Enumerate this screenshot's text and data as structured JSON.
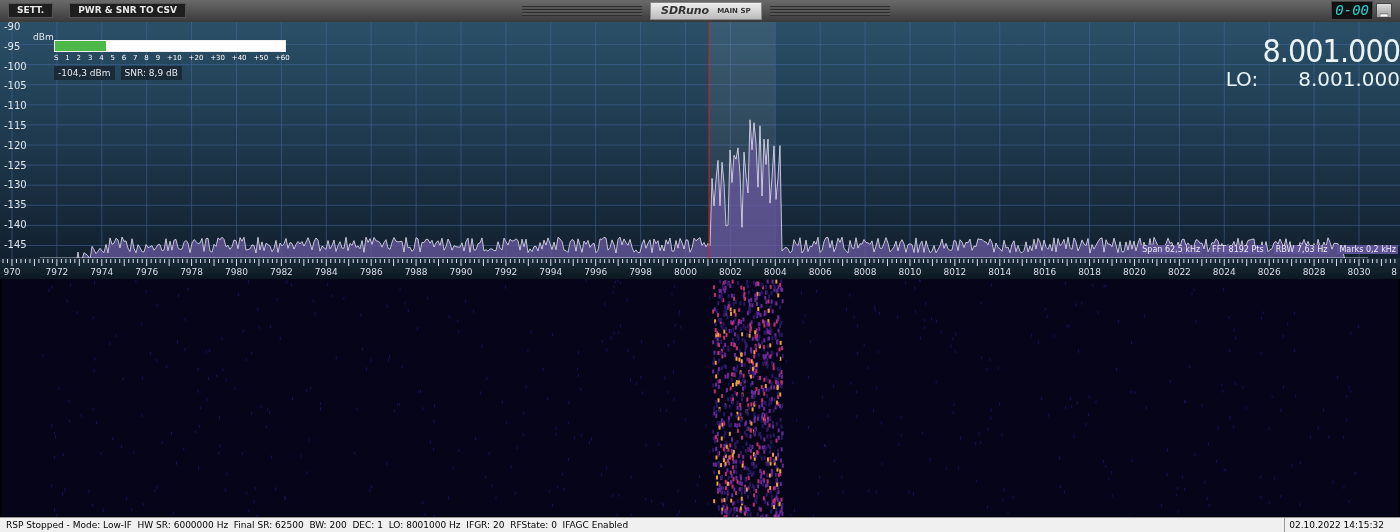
{
  "toolbar": {
    "buttons": [
      {
        "label": "SETT."
      },
      {
        "label": "PWR & SNR TO CSV"
      }
    ],
    "logo": "SDRuno",
    "panel_name": "MAIN SP",
    "clock": "0-00"
  },
  "spectrum": {
    "unit": "dBm",
    "y_axis": [
      "-90",
      "-95",
      "-100",
      "-105",
      "-110",
      "-115",
      "-120",
      "-125",
      "-130",
      "-135",
      "-140",
      "-145"
    ],
    "s_meter": {
      "level": 0.22,
      "scale": [
        "S",
        "1",
        "2",
        "3",
        "4",
        "5",
        "6",
        "7",
        "8",
        "9",
        "+10",
        "+20",
        "+30",
        "+40",
        "+50",
        "+60"
      ]
    },
    "power": "-104,3 dBm",
    "snr": "SNR: 8,9 dB",
    "frequency": "8.001.000",
    "lo_label": "LO:",
    "lo_value": "8.001.000",
    "info": [
      "Span 62,5 kHz",
      "FFT 8192 Pts",
      "RBW 7,63 Hz",
      "Marks 0,2 kHz"
    ],
    "x_axis": [
      "970",
      "7972",
      "7974",
      "7976",
      "7978",
      "7980",
      "7982",
      "7984",
      "7986",
      "7988",
      "7990",
      "7992",
      "7994",
      "7996",
      "7998",
      "8000",
      "8002",
      "8004",
      "8006",
      "8008",
      "8010",
      "8012",
      "8014",
      "8016",
      "8018",
      "8020",
      "8022",
      "8024",
      "8026",
      "8028",
      "8030",
      "8"
    ]
  },
  "status_bar": {
    "text": "RSP Stopped - Mode: Low-IF  HW SR: 6000000 Hz  Final SR: 62500  BW: 200  DEC: 1  LO: 8001000 Hz  IFGR: 20  RFState: 0  IFAGC Enabled",
    "time": "02.10.2022 14:15:32"
  }
}
